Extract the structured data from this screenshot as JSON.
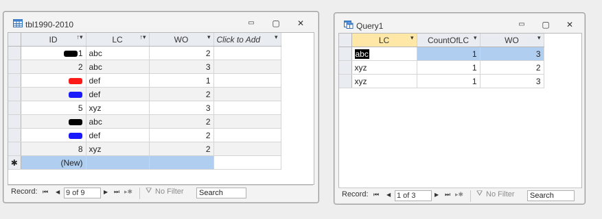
{
  "left_window": {
    "title": "tbl1990-2010",
    "icon": "table-icon",
    "controls": {
      "minimize": "▭",
      "restore": "▢",
      "close": "✕"
    },
    "columns": [
      "ID",
      "LC",
      "WO",
      "Click to Add"
    ],
    "rows": [
      {
        "id": "1",
        "redact": "#000000",
        "lc": "abc",
        "wo": "2"
      },
      {
        "id": "2",
        "redact": "",
        "lc": "abc",
        "wo": "3"
      },
      {
        "id": "",
        "redact": "#ff1a1a",
        "lc": "def",
        "wo": "1"
      },
      {
        "id": "",
        "redact": "#1a1aff",
        "lc": "def",
        "wo": "2"
      },
      {
        "id": "5",
        "redact": "",
        "lc": "xyz",
        "wo": "3"
      },
      {
        "id": "",
        "redact": "#000000",
        "lc": "abc",
        "wo": "2"
      },
      {
        "id": "",
        "redact": "#1a1aff",
        "lc": "def",
        "wo": "2"
      },
      {
        "id": "8",
        "redact": "",
        "lc": "xyz",
        "wo": "2"
      }
    ],
    "new_row_marker": "✱",
    "new_row_label": "(New)",
    "nav": {
      "record_label": "Record:",
      "first": "⏮",
      "prev": "◀",
      "record_value": "9 of 9",
      "next": "▶",
      "last": "⏭",
      "new": "▸✱",
      "filter_label": "No Filter",
      "search_placeholder": "Search"
    }
  },
  "right_window": {
    "title": "Query1",
    "icon": "query-icon",
    "controls": {
      "minimize": "▭",
      "restore": "▢",
      "close": "✕"
    },
    "columns": [
      "LC",
      "CountOfLC",
      "WO"
    ],
    "rows": [
      {
        "lc": "abc",
        "count": "1",
        "wo": "3"
      },
      {
        "lc": "xyz",
        "count": "1",
        "wo": "2"
      },
      {
        "lc": "xyz",
        "count": "1",
        "wo": "3"
      }
    ],
    "nav": {
      "record_label": "Record:",
      "first": "⏮",
      "prev": "◀",
      "record_value": "1 of 3",
      "next": "▶",
      "last": "⏭",
      "new": "▸✱",
      "filter_label": "No Filter",
      "search_placeholder": "Search"
    }
  }
}
